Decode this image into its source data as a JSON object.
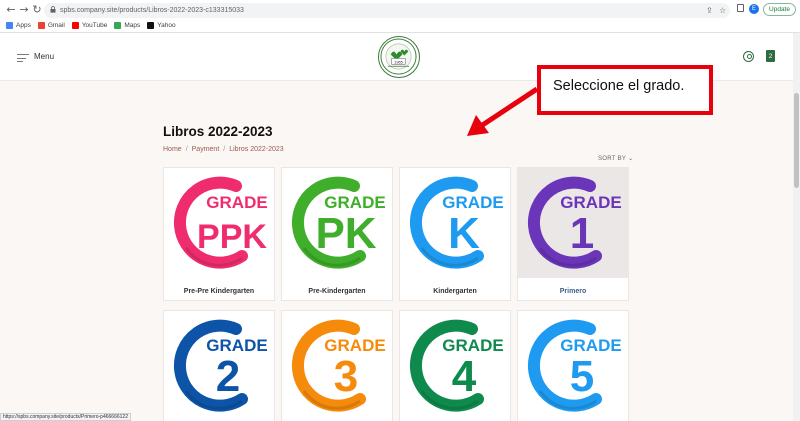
{
  "browser": {
    "url": "spbs.company.site/products/Libros-2022-2023-c133315033",
    "profile_initial": "E",
    "update_label": "Update",
    "bookmarks": [
      {
        "label": "Apps",
        "icon": "apps-grid-icon",
        "color": "#4285f4"
      },
      {
        "label": "Gmail",
        "icon": "gmail-icon",
        "color": "#ea4335"
      },
      {
        "label": "YouTube",
        "icon": "youtube-icon",
        "color": "#ff0000"
      },
      {
        "label": "Maps",
        "icon": "maps-pin-icon",
        "color": "#34a853"
      },
      {
        "label": "Yahoo",
        "icon": "yahoo-icon",
        "color": "#111111"
      }
    ],
    "status_url": "https://spbs.company.site/products/Primero-p466666122"
  },
  "header": {
    "menu_label": "Menu",
    "logo_text": "1965",
    "cart_count": "2"
  },
  "page": {
    "title": "Libros 2022-2023",
    "breadcrumb": [
      "Home",
      "Payment",
      "Libros 2022-2023"
    ],
    "sort_label": "SORT BY"
  },
  "products": [
    {
      "name": "Pre-Pre Kindergarten",
      "grade_word": "GRADE",
      "grade_mark": "PPK",
      "color": "#ef2d6e"
    },
    {
      "name": "Pre-Kindergarten",
      "grade_word": "GRADE",
      "grade_mark": "PK",
      "color": "#3fae2a"
    },
    {
      "name": "Kindergarten",
      "grade_word": "GRADE",
      "grade_mark": "K",
      "color": "#1e9bf0"
    },
    {
      "name": "Primero",
      "grade_word": "GRADE",
      "grade_mark": "1",
      "color": "#6a35b8"
    },
    {
      "name": "",
      "grade_word": "GRADE",
      "grade_mark": "2",
      "color": "#0d54a8"
    },
    {
      "name": "",
      "grade_word": "GRADE",
      "grade_mark": "3",
      "color": "#f58a0b"
    },
    {
      "name": "",
      "grade_word": "GRADE",
      "grade_mark": "4",
      "color": "#0f8a4d"
    },
    {
      "name": "",
      "grade_word": "GRADE",
      "grade_mark": "5",
      "color": "#1e9bf0"
    }
  ],
  "annotation": {
    "text": "Seleccione el grado.",
    "color": "#e8000d"
  }
}
